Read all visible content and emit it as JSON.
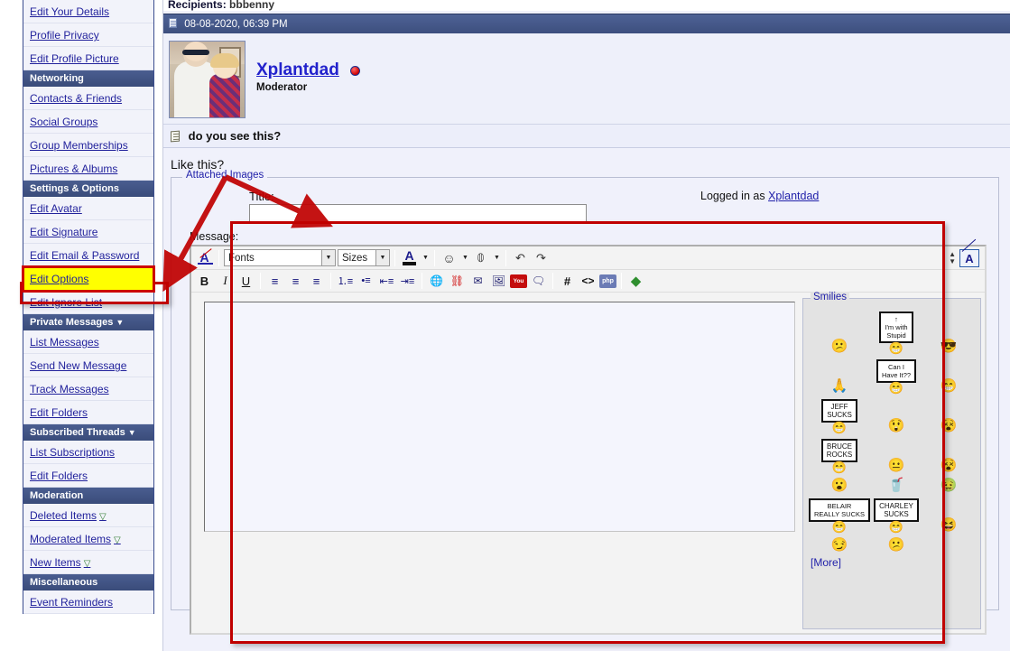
{
  "sidebar": {
    "groups": [
      {
        "header": null,
        "items": [
          {
            "label": "Edit Your Details",
            "name": "edit-your-details",
            "marker": null
          },
          {
            "label": "Profile Privacy",
            "name": "profile-privacy",
            "marker": null
          },
          {
            "label": "Edit Profile Picture",
            "name": "edit-profile-picture",
            "marker": null
          }
        ]
      },
      {
        "header": "Networking",
        "header_caret": "",
        "items": [
          {
            "label": "Contacts & Friends",
            "name": "contacts-and-friends",
            "marker": null
          },
          {
            "label": "Social Groups",
            "name": "social-groups",
            "marker": null
          },
          {
            "label": "Group Memberships",
            "name": "group-memberships",
            "marker": null
          },
          {
            "label": "Pictures & Albums",
            "name": "pictures-and-albums",
            "marker": null
          }
        ]
      },
      {
        "header": "Settings & Options",
        "header_caret": "",
        "items": [
          {
            "label": "Edit Avatar",
            "name": "edit-avatar",
            "marker": null
          },
          {
            "label": "Edit Signature",
            "name": "edit-signature",
            "marker": null
          },
          {
            "label": "Edit Email & Password",
            "name": "edit-email-and-password",
            "marker": null
          },
          {
            "label": "Edit Options",
            "name": "edit-options",
            "marker": null,
            "highlighted": true
          },
          {
            "label": "Edit Ignore List",
            "name": "edit-ignore-list",
            "marker": null
          }
        ]
      },
      {
        "header": "Private Messages",
        "header_caret": "▼",
        "items": [
          {
            "label": "List Messages",
            "name": "list-messages",
            "marker": null
          },
          {
            "label": "Send New Message",
            "name": "send-new-message",
            "marker": null
          },
          {
            "label": "Track Messages",
            "name": "track-messages",
            "marker": null
          },
          {
            "label": "Edit Folders",
            "name": "edit-folders-pm",
            "marker": null
          }
        ]
      },
      {
        "header": "Subscribed Threads",
        "header_caret": "▼",
        "items": [
          {
            "label": "List Subscriptions",
            "name": "list-subscriptions",
            "marker": null
          },
          {
            "label": "Edit Folders",
            "name": "edit-folders-subs",
            "marker": null
          }
        ]
      },
      {
        "header": "Moderation",
        "header_caret": "",
        "items": [
          {
            "label": "Deleted Items",
            "name": "deleted-items",
            "marker": "▽"
          },
          {
            "label": "Moderated Items",
            "name": "moderated-items",
            "marker": "▽"
          },
          {
            "label": "New Items",
            "name": "new-items",
            "marker": "▽"
          }
        ]
      },
      {
        "header": "Miscellaneous",
        "header_caret": "",
        "items": [
          {
            "label": "Event Reminders",
            "name": "event-reminders",
            "marker": null
          }
        ]
      }
    ]
  },
  "main": {
    "recipients_label": "Recipients",
    "recipients_value": "bbbenny",
    "post_date": "08-08-2020, 06:39 PM",
    "poster_name": "Xplantdad",
    "poster_role": "Moderator",
    "subject": "do you see this?",
    "body_text": "Like this?",
    "attached_images_legend": "Attached Images",
    "title_label": "Title:",
    "title_value": "",
    "title_placeholder": "",
    "logged_in_prefix": "Logged in as ",
    "logged_in_user": "Xplantdad",
    "message_label": "Message:",
    "message_value": ""
  },
  "editor": {
    "toolbar_row1": [
      {
        "name": "remove-formatting-icon",
        "glyph": "A"
      },
      {
        "name": "font-family-select",
        "glyph": "Fonts",
        "type": "select"
      },
      {
        "name": "font-size-select",
        "glyph": "Sizes",
        "type": "select"
      },
      {
        "name": "font-color-icon",
        "glyph": "A"
      },
      {
        "name": "smilie-insert-icon",
        "glyph": "☺"
      },
      {
        "name": "attachment-icon",
        "glyph": "🖇"
      },
      {
        "name": "undo-icon",
        "glyph": "↶"
      },
      {
        "name": "redo-icon",
        "glyph": "↷"
      }
    ],
    "fonts_label": "Fonts",
    "sizes_label": "Sizes",
    "toolbar_row2": [
      {
        "name": "bold-icon",
        "glyph": "B"
      },
      {
        "name": "italic-icon",
        "glyph": "I"
      },
      {
        "name": "underline-icon",
        "glyph": "U"
      },
      {
        "name": "align-left-icon",
        "glyph": "≡"
      },
      {
        "name": "align-center-icon",
        "glyph": "≡"
      },
      {
        "name": "align-right-icon",
        "glyph": "≡"
      },
      {
        "name": "ordered-list-icon",
        "glyph": "⒈"
      },
      {
        "name": "unordered-list-icon",
        "glyph": "•"
      },
      {
        "name": "outdent-icon",
        "glyph": "⇤"
      },
      {
        "name": "indent-icon",
        "glyph": "⇥"
      },
      {
        "name": "insert-link-icon",
        "glyph": "🌐"
      },
      {
        "name": "remove-link-icon",
        "glyph": "⛓"
      },
      {
        "name": "insert-email-icon",
        "glyph": "✉"
      },
      {
        "name": "insert-image-icon",
        "glyph": "🖼"
      },
      {
        "name": "insert-youtube-icon",
        "glyph": "You"
      },
      {
        "name": "insert-quote-icon",
        "glyph": "❝"
      },
      {
        "name": "insert-code-icon",
        "glyph": "#"
      },
      {
        "name": "insert-html-icon",
        "glyph": "<>"
      },
      {
        "name": "insert-php-icon",
        "glyph": "php"
      },
      {
        "name": "wrap-tags-icon",
        "glyph": "◆"
      }
    ],
    "youtube_label": "You",
    "php_label": "php",
    "code_label": "#",
    "html_label": "<>",
    "wysiwyg_toggle_label": "A",
    "smilies_legend": "Smilies",
    "more_link": "[More]",
    "smilies": [
      {
        "name": "smiley-confused",
        "kind": "face",
        "glyph": "😕"
      },
      {
        "name": "smiley-im-with-stupid-sign",
        "kind": "sign",
        "text": "↑\nI'm with\nStupid"
      },
      {
        "name": "smiley-cool-sunglasses",
        "kind": "face",
        "glyph": "😎"
      },
      {
        "name": "smiley-pleading-hands",
        "kind": "face",
        "glyph": "🙏"
      },
      {
        "name": "smiley-can-i-have-it-sign",
        "kind": "sign",
        "text": "Can I\nHave It??"
      },
      {
        "name": "smiley-grin",
        "kind": "face",
        "glyph": "😁"
      },
      {
        "name": "smiley-jeff-sucks-sign",
        "kind": "sign",
        "text": "JEFF\nSUCKS"
      },
      {
        "name": "smiley-shocked",
        "kind": "face",
        "glyph": "😲"
      },
      {
        "name": "smiley-bonk-head",
        "kind": "face",
        "glyph": "😵"
      },
      {
        "name": "smiley-bruce-rocks-sign",
        "kind": "sign",
        "text": "BRUCE\nROCKS"
      },
      {
        "name": "smiley-zipper-mouth",
        "kind": "face",
        "glyph": "😐"
      },
      {
        "name": "smiley-wand",
        "kind": "face",
        "glyph": "😵"
      },
      {
        "name": "smiley-surprised-small",
        "kind": "face",
        "glyph": "😮"
      },
      {
        "name": "smiley-drink",
        "kind": "face",
        "glyph": "🥤"
      },
      {
        "name": "smiley-sick",
        "kind": "face",
        "glyph": "🤢"
      },
      {
        "name": "smiley-belair-really-sucks-sign",
        "kind": "sign",
        "text": "BELAIR\nREALLY SUCKS"
      },
      {
        "name": "smiley-charley-sucks-sign",
        "kind": "sign",
        "text": "CHARLEY\nSUCKS"
      },
      {
        "name": "smiley-laughing",
        "kind": "face",
        "glyph": "😆"
      },
      {
        "name": "smiley-smirk",
        "kind": "face",
        "glyph": "😏"
      },
      {
        "name": "smiley-confused-question",
        "kind": "face",
        "glyph": "😕"
      }
    ]
  },
  "colors": {
    "nav_header_bg": "#3e5180",
    "nav_link_text": "#22229c",
    "highlight_bg": "#ffff00",
    "annotation_red": "#c00000",
    "post_header_bg": "#43568a",
    "page_bg": "#f0f1fb"
  }
}
